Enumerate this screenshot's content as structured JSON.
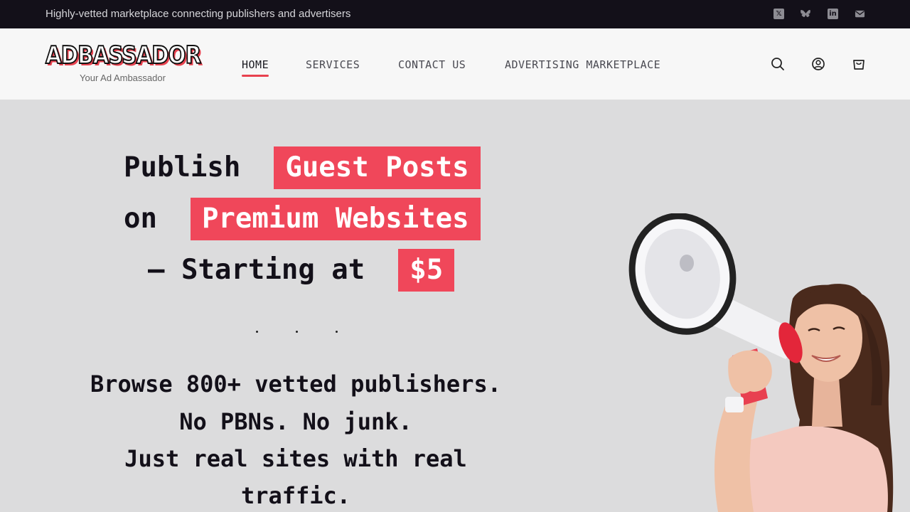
{
  "topbar": {
    "text": "Highly-vetted marketplace connecting publishers and advertisers",
    "social": [
      "x-icon",
      "bluesky-icon",
      "linkedin-icon",
      "email-icon"
    ]
  },
  "header": {
    "logo_text": "ADBASSADOR",
    "tagline": "Your Ad Ambassador",
    "nav": [
      {
        "label": "HOME",
        "active": true
      },
      {
        "label": "SERVICES",
        "active": false
      },
      {
        "label": "CONTACT US",
        "active": false
      },
      {
        "label": "ADVERTISING MARKETPLACE",
        "active": false
      }
    ],
    "icons": [
      "search-icon",
      "account-icon",
      "cart-icon"
    ]
  },
  "hero": {
    "line1_prefix": "Publish",
    "line1_highlight": "Guest Posts",
    "line2_prefix": "on",
    "line2_highlight": "Premium Websites",
    "line3_prefix": "— Starting at",
    "line3_highlight": "$5",
    "sub1": "Browse 800+ vetted publishers.",
    "sub2": "No PBNs. No junk.",
    "sub3": "Just real sites with real",
    "sub4": "traffic."
  },
  "colors": {
    "accent": "#f0475a",
    "topbar_bg": "#131019",
    "header_bg": "#f7f7f7",
    "hero_bg": "#dcdcdd"
  }
}
